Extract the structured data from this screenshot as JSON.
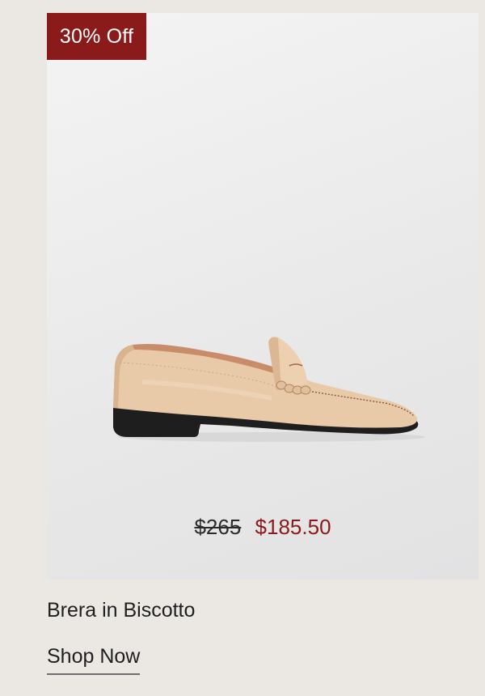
{
  "badge": {
    "label": "30% Off"
  },
  "product": {
    "name": "Brera in Biscotto",
    "image_alt": "Tan leather penny loafer with black sole",
    "price_original": "$265",
    "price_sale": "$185.50"
  },
  "cta": {
    "label": "Shop Now"
  },
  "colors": {
    "page_bg": "#ebe8e4",
    "badge_bg": "#8b1a1a",
    "sale_price": "#8b1a1a",
    "shoe_leather": "#e8c9a8",
    "shoe_sole": "#1e1e1e"
  }
}
